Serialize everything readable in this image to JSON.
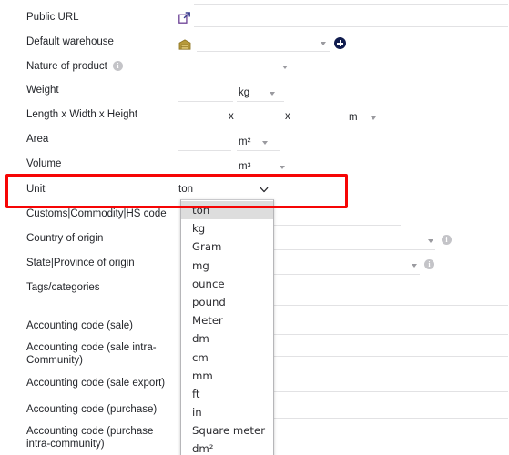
{
  "form": {
    "rows": [
      {
        "label": "Public URL",
        "icon": "external-link-icon"
      },
      {
        "label": "Default warehouse",
        "icon": "warehouse-icon"
      },
      {
        "label": "Nature of product",
        "icon": "info-icon"
      },
      {
        "label": "Weight",
        "unit": "kg"
      },
      {
        "label": "Length x Width x Height",
        "sep1": "x",
        "sep2": "x",
        "unit": "m"
      },
      {
        "label": "Area",
        "unit": "m²"
      },
      {
        "label": "Volume",
        "unit": "m³"
      },
      {
        "label": "Unit"
      },
      {
        "label": "Customs|Commodity|HS code"
      },
      {
        "label": "Country of origin"
      },
      {
        "label": "State|Province of origin"
      },
      {
        "label": "Tags/categories"
      },
      {
        "label": "Accounting code (sale)"
      },
      {
        "label": "Accounting code (sale intra-Community)"
      },
      {
        "label": "Accounting code (sale export)"
      },
      {
        "label": "Accounting code (purchase)"
      },
      {
        "label": "Accounting code (purchase intra-community)"
      }
    ]
  },
  "unit_field": {
    "label": "Unit",
    "value": "ton",
    "chevron_icon": "chevron-down-icon",
    "options": [
      "ton",
      "kg",
      "Gram",
      "mg",
      "ounce",
      "pound",
      "Meter",
      "dm",
      "cm",
      "mm",
      "ft",
      "in",
      "Square meter",
      "dm²"
    ],
    "selected_index": 0
  },
  "highlight": {
    "color": "#f60505",
    "target": "unit-row"
  },
  "icons": {
    "external_link": "external-link-icon",
    "warehouse": "warehouse-icon",
    "add": "plus-circle-icon",
    "info": "info-icon",
    "dropdown_caret": "caret-down-icon"
  }
}
